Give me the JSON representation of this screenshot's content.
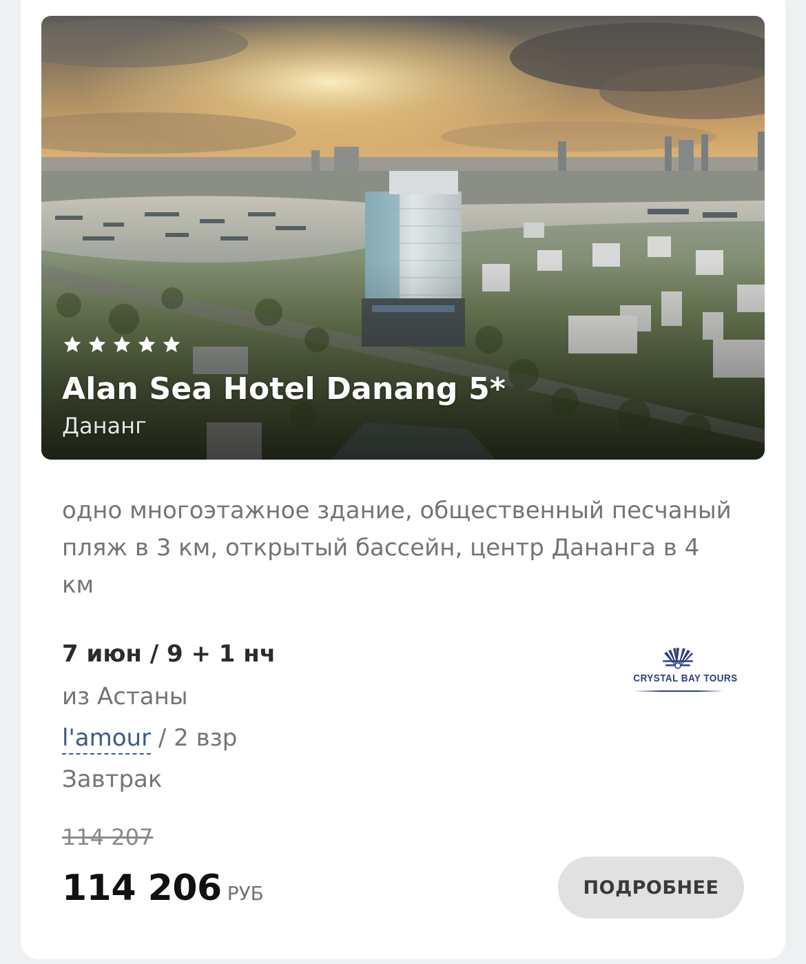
{
  "hotel": {
    "rating_stars": 5,
    "name": "Alan Sea Hotel Danang 5*",
    "city": "Дананг",
    "description": "одно многоэтажное здание, общественный песчаный пляж в 3 км, открытый бассейн, центр Дананга в 4 км",
    "image": "aerial-city-river-sunset-photo"
  },
  "tour": {
    "dates": "7 июн / 9 + 1 нч",
    "departure": "из Астаны",
    "room_type": "l'amour",
    "room_separator": " / ",
    "guests": "2 взр",
    "meal": "Завтрак"
  },
  "price": {
    "old": "114 207",
    "current": "114 206",
    "currency": "РУБ"
  },
  "operator": {
    "name": "CRYSTAL BAY TOURS",
    "logo_icon": "crystal-bay-fan-icon",
    "color": "#2b3e7d"
  },
  "actions": {
    "details_label": "ПОДРОБНЕЕ"
  },
  "colors": {
    "link": "#3b5b86",
    "muted_text": "#747474",
    "button_bg": "#e1e1e1"
  }
}
